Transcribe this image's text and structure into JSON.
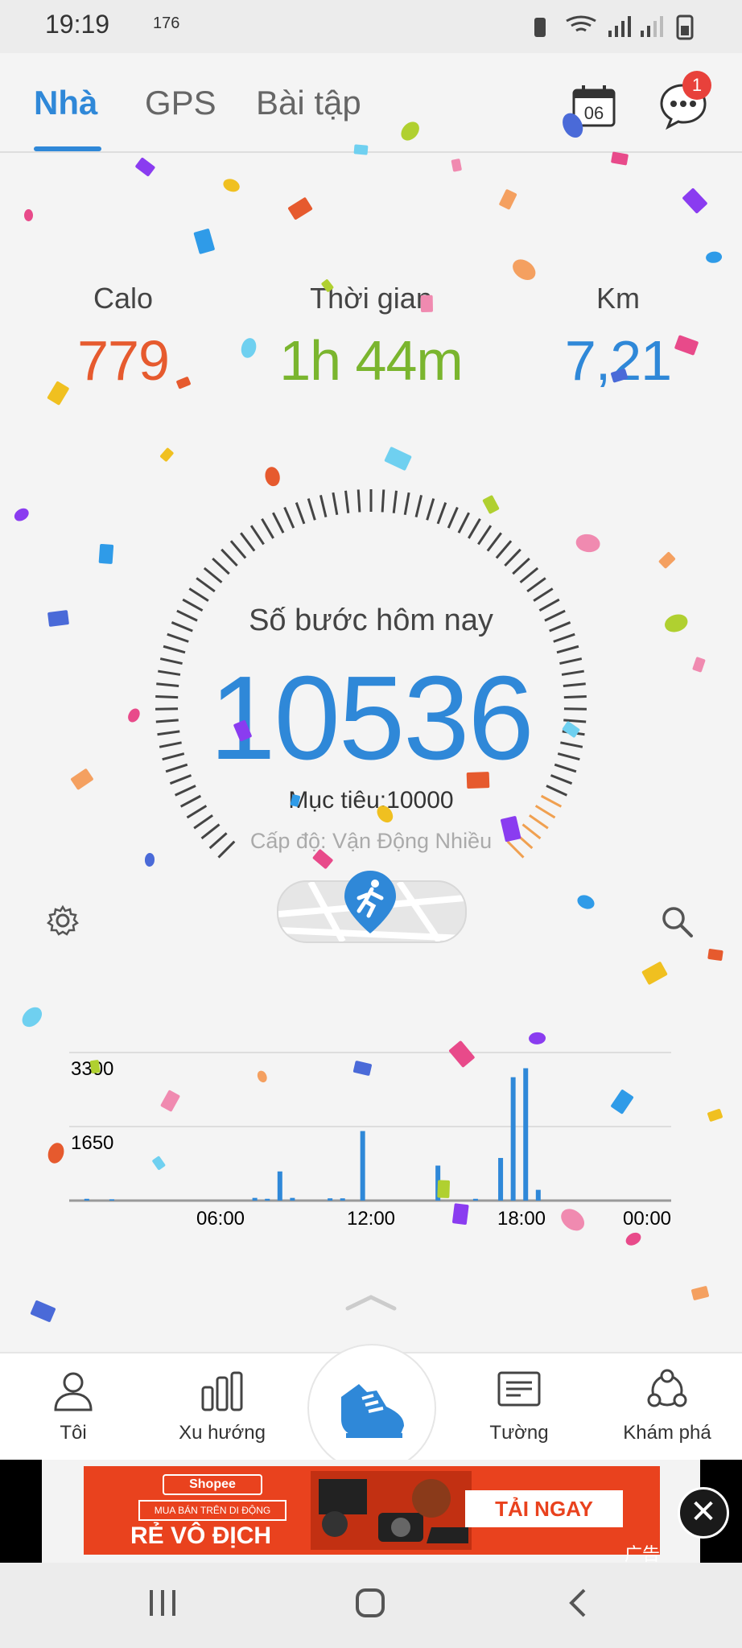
{
  "status_bar": {
    "time": "19:19",
    "indicators": "176",
    "right_icons": "mute wifi signal battery"
  },
  "tabs": [
    {
      "label": "Nhà"
    },
    {
      "label": "GPS"
    },
    {
      "label": "Bài tập"
    }
  ],
  "calendar_day": "06",
  "message_badge": "1",
  "stats": [
    {
      "label": "Calo",
      "value": "779",
      "color": "#e65a2e"
    },
    {
      "label": "Thời gian",
      "value": "1h 44m",
      "color": "#7ab52e"
    },
    {
      "label": "Km",
      "value": "7,21",
      "color": "#2f88d8"
    }
  ],
  "steps": {
    "label": "Số bước hôm nay",
    "value": "10536",
    "goal": "Mục tiêu:10000",
    "level": "Cấp độ: Vận Động Nhiều"
  },
  "chart_data": {
    "type": "bar",
    "y_ticks": [
      "3300",
      "1650"
    ],
    "ylim": [
      0,
      3300
    ],
    "x_ticks": [
      "06:00",
      "12:00",
      "18:00",
      "00:00"
    ],
    "bars": [
      {
        "x": 0.7,
        "v": 40
      },
      {
        "x": 1.7,
        "v": 30
      },
      {
        "x": 7.4,
        "v": 60
      },
      {
        "x": 7.9,
        "v": 40
      },
      {
        "x": 8.4,
        "v": 650
      },
      {
        "x": 8.9,
        "v": 60
      },
      {
        "x": 10.4,
        "v": 50
      },
      {
        "x": 10.9,
        "v": 50
      },
      {
        "x": 11.7,
        "v": 1550
      },
      {
        "x": 14.7,
        "v": 780
      },
      {
        "x": 16.2,
        "v": 40
      },
      {
        "x": 17.2,
        "v": 950
      },
      {
        "x": 17.7,
        "v": 2750
      },
      {
        "x": 18.2,
        "v": 2950
      },
      {
        "x": 18.7,
        "v": 240
      }
    ]
  },
  "bottom_nav": [
    {
      "label": "Tôi"
    },
    {
      "label": "Xu hướng"
    },
    {
      "label": ""
    },
    {
      "label": "Tường"
    },
    {
      "label": "Khám phá"
    }
  ],
  "ad": {
    "brand": "Shopee",
    "tagline": "MUA BÁN TRÊN DI ĐỘNG",
    "headline": "RẺ VÔ ĐỊCH",
    "cta": "TẢI NGAY",
    "tag": "广告"
  },
  "colors": {
    "accent": "#2f88d8",
    "calories": "#e65a2e",
    "time": "#7ab52e",
    "distance": "#2f88d8"
  }
}
